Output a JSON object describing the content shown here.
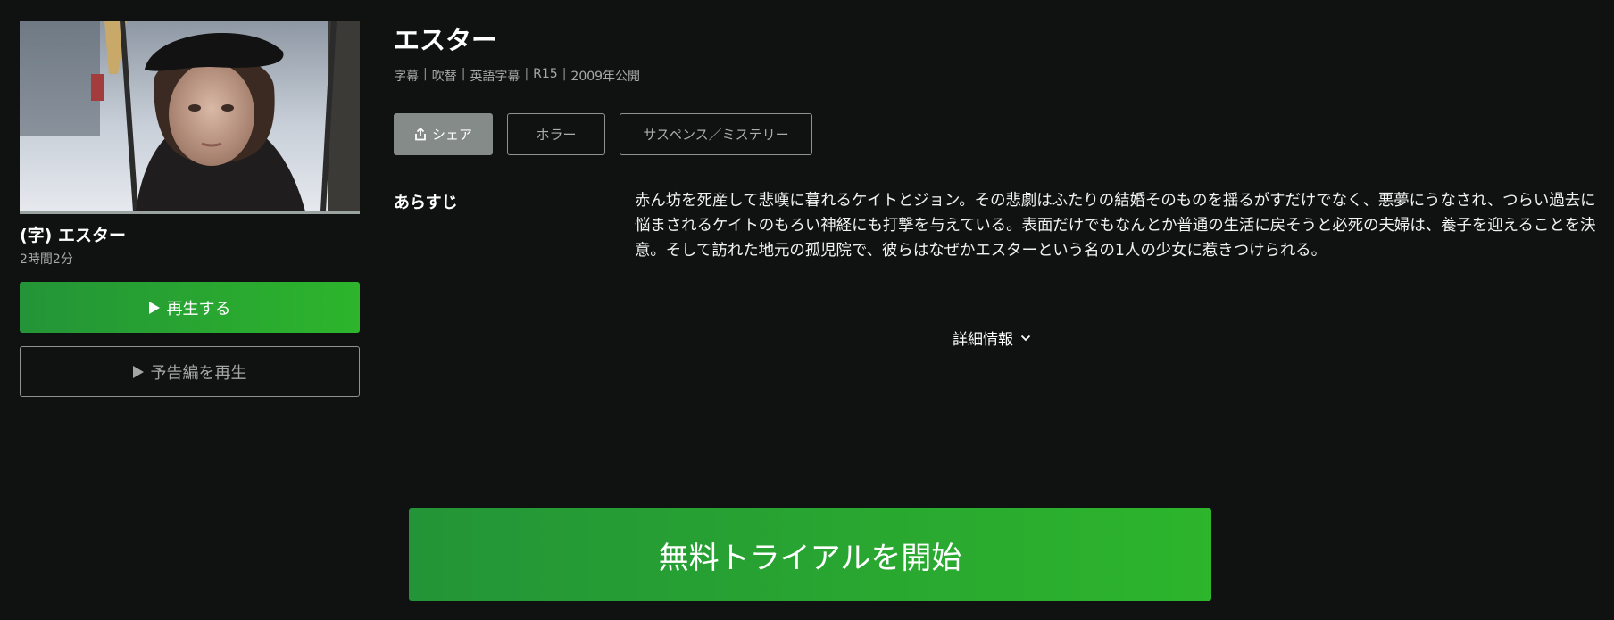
{
  "episode": {
    "title": "(字) エスター",
    "duration": "2時間2分",
    "play_label": "再生する",
    "trailer_label": "予告編を再生"
  },
  "title": "エスター",
  "meta": [
    "字幕",
    "吹替",
    "英語字幕",
    "R15",
    "2009年公開"
  ],
  "meta_separator": "|",
  "tags": {
    "share": "シェア",
    "genre1": "ホラー",
    "genre2": "サスペンス／ミステリー"
  },
  "synopsis": {
    "label": "あらすじ",
    "text": "赤ん坊を死産して悲嘆に暮れるケイトとジョン。その悲劇はふたりの結婚そのものを揺るがすだけでなく、悪夢にうなされ、つらい過去に悩まされるケイトのもろい神経にも打撃を与えている。表面だけでもなんとか普通の生活に戻そうと必死の夫婦は、養子を迎えることを決意。そして訪れた地元の孤児院で、彼らはなぜかエスターという名の1人の少女に惹きつけられる。"
  },
  "details_label": "詳細情報",
  "cta_label": "無料トライアルを開始",
  "icons": {
    "play": "play-icon",
    "share": "share-icon",
    "details": "chevron-down-icon"
  },
  "colors": {
    "background": "#101212",
    "accent_green_start": "#239437",
    "accent_green_end": "#2db52c",
    "muted_text": "#a4a9a7",
    "share_bg": "#848b88"
  }
}
